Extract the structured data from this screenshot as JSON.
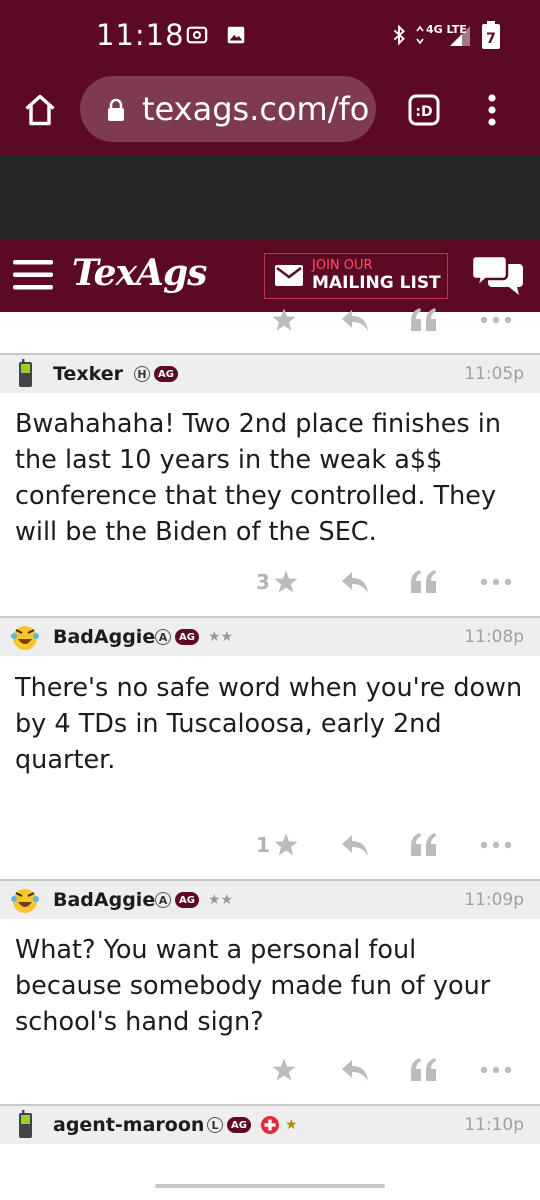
{
  "status_bar": {
    "time": "11:18",
    "network": "4G LTE",
    "battery_level": "7"
  },
  "browser": {
    "url": "texags.com/fo"
  },
  "site_nav": {
    "logo": "TexAgs",
    "mailing_line1": "JOIN OUR",
    "mailing_line2": "MAILING LIST"
  },
  "posts": [
    {
      "user": "Texker",
      "badge_letter": "H",
      "ag_badge": "AG",
      "stars": "",
      "time": "11:05p",
      "text": "Bwahahaha! Two 2nd place finishes in the last 10 years in the weak a$$ conference that they controlled. They will be the Biden of the SEC.",
      "star_count": "3"
    },
    {
      "user": "BadAggie",
      "badge_letter": "A",
      "ag_badge": "AG",
      "stars": "★★",
      "time": "11:08p",
      "text": "There's no safe word when you're down by 4 TDs in Tuscaloosa, early 2nd quarter.",
      "star_count": "1"
    },
    {
      "user": "BadAggie",
      "badge_letter": "A",
      "ag_badge": "AG",
      "stars": "★★",
      "time": "11:09p",
      "text": "What? You want a personal foul because somebody made fun of your school's hand sign?",
      "star_count": ""
    },
    {
      "user": "agent-maroon",
      "badge_letter": "L",
      "ag_badge": "AG",
      "stars": "★",
      "time": "11:10p",
      "text": "",
      "star_count": ""
    }
  ],
  "icons": [
    "home-icon",
    "lock-icon",
    "reader-mode-icon",
    "more-vert-icon",
    "hamburger-menu-icon",
    "mail-icon",
    "chat-icon",
    "star-icon",
    "reply-icon",
    "quote-icon",
    "ellipsis-icon"
  ],
  "colors": {
    "maroon": "#5c0a24",
    "url_pill": "#7e3a4e",
    "header_gray": "#eeeeee",
    "action_gray": "#bcbcbc"
  }
}
